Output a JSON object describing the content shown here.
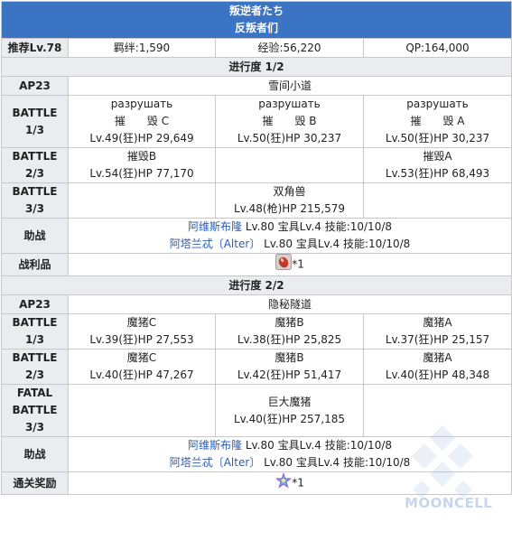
{
  "title": {
    "line1": "叛逆者たち",
    "line2": "反叛者们"
  },
  "rec": {
    "label": "推荐Lv.78",
    "bond": "羁绊:1,590",
    "exp": "经验:56,220",
    "qp": "QP:164,000"
  },
  "parts": [
    {
      "header": "进行度 1/2",
      "ap": "AP23",
      "location": "雪间小道",
      "waves": [
        {
          "label1": "BATTLE",
          "label2": "1/3",
          "enemies": [
            {
              "lines": [
                "разрушать",
                "摧　　毁 C",
                "Lv.49(狂)HP 29,649"
              ]
            },
            {
              "lines": [
                "разрушать",
                "摧　　毁 B",
                "Lv.50(狂)HP 30,237"
              ]
            },
            {
              "lines": [
                "разрушать",
                "摧　　毁 A",
                "Lv.50(狂)HP 30,237"
              ]
            }
          ]
        },
        {
          "label1": "BATTLE",
          "label2": "2/3",
          "enemies": [
            {
              "lines": [
                "摧毁B",
                "Lv.54(狂)HP 77,170"
              ]
            },
            {
              "lines": []
            },
            {
              "lines": [
                "摧毁A",
                "Lv.53(狂)HP 68,493"
              ]
            }
          ]
        },
        {
          "label1": "BATTLE",
          "label2": "3/3",
          "enemies": [
            {
              "lines": []
            },
            {
              "lines": [
                "双角兽",
                "Lv.48(枪)HP 215,579"
              ]
            },
            {
              "lines": []
            }
          ]
        }
      ],
      "support_label": "助战",
      "support": [
        {
          "name": "阿维斯布隆",
          "info": " Lv.80 宝具Lv.4 技能:10/10/8"
        },
        {
          "name": "阿塔兰忒〔Alter〕",
          "info": " Lv.80 宝具Lv.4 技能:10/10/8"
        }
      ],
      "reward_label": "战利品",
      "reward_icon": "crimson-gem-icon",
      "reward_count": "*1"
    },
    {
      "header": "进行度 2/2",
      "ap": "AP23",
      "location": "隐秘隧道",
      "waves": [
        {
          "label1": "BATTLE",
          "label2": "1/3",
          "enemies": [
            {
              "lines": [
                "魔猪C",
                "Lv.39(狂)HP 27,553"
              ]
            },
            {
              "lines": [
                "魔猪B",
                "Lv.38(狂)HP 25,825"
              ]
            },
            {
              "lines": [
                "魔猪A",
                "Lv.37(狂)HP 25,157"
              ]
            }
          ]
        },
        {
          "label1": "BATTLE",
          "label2": "2/3",
          "enemies": [
            {
              "lines": [
                "魔猪C",
                "Lv.40(狂)HP 47,267"
              ]
            },
            {
              "lines": [
                "魔猪B",
                "Lv.42(狂)HP 51,417"
              ]
            },
            {
              "lines": [
                "魔猪A",
                "Lv.40(狂)HP 48,348"
              ]
            }
          ]
        },
        {
          "label1": "FATAL",
          "label2": "BATTLE",
          "label3": "3/3",
          "enemies": [
            {
              "lines": []
            },
            {
              "lines": [
                "巨大魔猪",
                "Lv.40(狂)HP 257,185"
              ]
            },
            {
              "lines": []
            }
          ]
        }
      ],
      "support_label": "助战",
      "support": [
        {
          "name": "阿维斯布隆",
          "info": " Lv.80 宝具Lv.4 技能:10/10/8"
        },
        {
          "name": "阿塔兰忒〔Alter〕",
          "info": " Lv.80 宝具Lv.4 技能:10/10/8"
        }
      ],
      "reward_label": "通关奖励",
      "reward_icon": "saint-quartz-icon",
      "reward_count": "*1"
    }
  ],
  "watermark": "MOONCELL",
  "colors": {
    "title_bg": "#3c74c4",
    "header_bg": "#eaecf0",
    "link": "#2a5db0",
    "border": "#c8c8c8"
  }
}
